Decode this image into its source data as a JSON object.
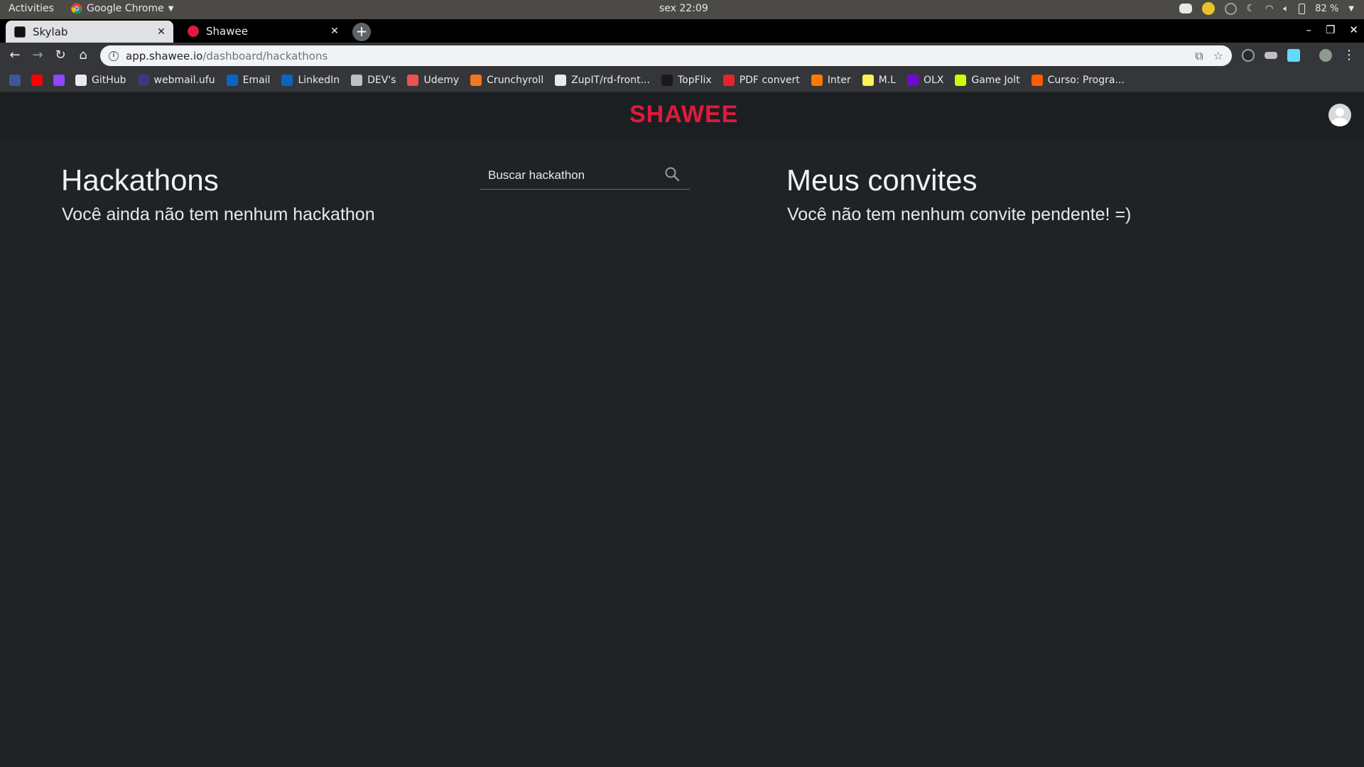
{
  "system": {
    "activities": "Activities",
    "app_name": "Google Chrome",
    "clock": "sex 22:09",
    "battery": "82 %"
  },
  "tabs": [
    {
      "title": "Skylab",
      "favicon": "skylab-icon"
    },
    {
      "title": "Shawee",
      "favicon": "shawee-icon"
    }
  ],
  "address_bar": {
    "domain": "app.shawee.io",
    "path": "/dashboard/hackathons"
  },
  "bookmarks": [
    {
      "label": "",
      "icon": "facebook-icon",
      "color": "#3b5998"
    },
    {
      "label": "",
      "icon": "youtube-icon",
      "color": "#ff0000"
    },
    {
      "label": "",
      "icon": "twitch-icon",
      "color": "#9146ff"
    },
    {
      "label": "GitHub",
      "icon": "github-icon",
      "color": "#e8eaed"
    },
    {
      "label": "webmail.ufu",
      "icon": "webmail-icon",
      "color": "#3a3a7a"
    },
    {
      "label": "Email",
      "icon": "outlook-icon",
      "color": "#0a64c8"
    },
    {
      "label": "LinkedIn",
      "icon": "linkedin-icon",
      "color": "#0a66c2"
    },
    {
      "label": "DEV's",
      "icon": "folder-icon",
      "color": "#bdc1c6"
    },
    {
      "label": "Udemy",
      "icon": "udemy-icon",
      "color": "#ec5252"
    },
    {
      "label": "Crunchyroll",
      "icon": "crunchyroll-icon",
      "color": "#f47521"
    },
    {
      "label": "ZupIT/rd-front...",
      "icon": "github-icon",
      "color": "#e8eaed"
    },
    {
      "label": "TopFlix",
      "icon": "topflix-icon",
      "color": "#1a1a1a"
    },
    {
      "label": "PDF convert",
      "icon": "pdf-icon",
      "color": "#e5252a"
    },
    {
      "label": "Inter",
      "icon": "inter-icon",
      "color": "#ff7a00"
    },
    {
      "label": "M.L",
      "icon": "mercadolivre-icon",
      "color": "#fff159"
    },
    {
      "label": "OLX",
      "icon": "olx-icon",
      "color": "#6e0ad6"
    },
    {
      "label": "Game Jolt",
      "icon": "gamejolt-icon",
      "color": "#ccff00"
    },
    {
      "label": "Curso: Progra...",
      "icon": "alura-icon",
      "color": "#ff5f00"
    }
  ],
  "app": {
    "logo": "SHAWEE",
    "logo_color": "#e0193d",
    "hackathons_title": "Hackathons",
    "hackathons_empty": "Você ainda não tem nenhum hackathon",
    "search_placeholder": "Buscar hackathon",
    "invites_title": "Meus convites",
    "invites_empty": "Você não tem nenhum convite pendente! =)"
  }
}
